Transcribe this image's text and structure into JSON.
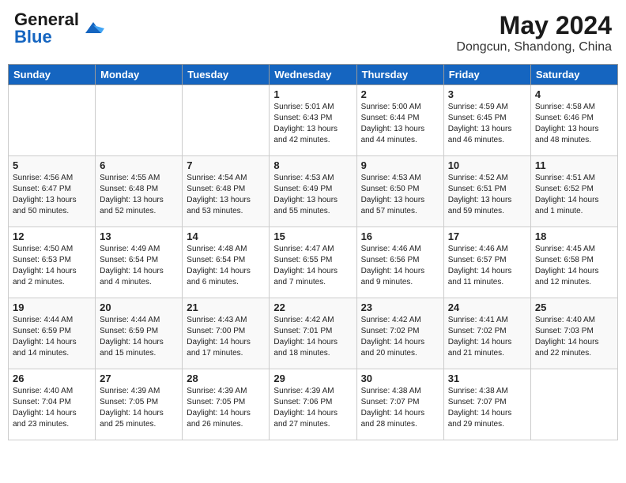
{
  "app": {
    "name": "GeneralBlue",
    "title": "May 2024",
    "subtitle": "Dongcun, Shandong, China"
  },
  "weekdays": [
    "Sunday",
    "Monday",
    "Tuesday",
    "Wednesday",
    "Thursday",
    "Friday",
    "Saturday"
  ],
  "weeks": [
    [
      {
        "day": "",
        "info": ""
      },
      {
        "day": "",
        "info": ""
      },
      {
        "day": "",
        "info": ""
      },
      {
        "day": "1",
        "info": "Sunrise: 5:01 AM\nSunset: 6:43 PM\nDaylight: 13 hours\nand 42 minutes."
      },
      {
        "day": "2",
        "info": "Sunrise: 5:00 AM\nSunset: 6:44 PM\nDaylight: 13 hours\nand 44 minutes."
      },
      {
        "day": "3",
        "info": "Sunrise: 4:59 AM\nSunset: 6:45 PM\nDaylight: 13 hours\nand 46 minutes."
      },
      {
        "day": "4",
        "info": "Sunrise: 4:58 AM\nSunset: 6:46 PM\nDaylight: 13 hours\nand 48 minutes."
      }
    ],
    [
      {
        "day": "5",
        "info": "Sunrise: 4:56 AM\nSunset: 6:47 PM\nDaylight: 13 hours\nand 50 minutes."
      },
      {
        "day": "6",
        "info": "Sunrise: 4:55 AM\nSunset: 6:48 PM\nDaylight: 13 hours\nand 52 minutes."
      },
      {
        "day": "7",
        "info": "Sunrise: 4:54 AM\nSunset: 6:48 PM\nDaylight: 13 hours\nand 53 minutes."
      },
      {
        "day": "8",
        "info": "Sunrise: 4:53 AM\nSunset: 6:49 PM\nDaylight: 13 hours\nand 55 minutes."
      },
      {
        "day": "9",
        "info": "Sunrise: 4:53 AM\nSunset: 6:50 PM\nDaylight: 13 hours\nand 57 minutes."
      },
      {
        "day": "10",
        "info": "Sunrise: 4:52 AM\nSunset: 6:51 PM\nDaylight: 13 hours\nand 59 minutes."
      },
      {
        "day": "11",
        "info": "Sunrise: 4:51 AM\nSunset: 6:52 PM\nDaylight: 14 hours\nand 1 minute."
      }
    ],
    [
      {
        "day": "12",
        "info": "Sunrise: 4:50 AM\nSunset: 6:53 PM\nDaylight: 14 hours\nand 2 minutes."
      },
      {
        "day": "13",
        "info": "Sunrise: 4:49 AM\nSunset: 6:54 PM\nDaylight: 14 hours\nand 4 minutes."
      },
      {
        "day": "14",
        "info": "Sunrise: 4:48 AM\nSunset: 6:54 PM\nDaylight: 14 hours\nand 6 minutes."
      },
      {
        "day": "15",
        "info": "Sunrise: 4:47 AM\nSunset: 6:55 PM\nDaylight: 14 hours\nand 7 minutes."
      },
      {
        "day": "16",
        "info": "Sunrise: 4:46 AM\nSunset: 6:56 PM\nDaylight: 14 hours\nand 9 minutes."
      },
      {
        "day": "17",
        "info": "Sunrise: 4:46 AM\nSunset: 6:57 PM\nDaylight: 14 hours\nand 11 minutes."
      },
      {
        "day": "18",
        "info": "Sunrise: 4:45 AM\nSunset: 6:58 PM\nDaylight: 14 hours\nand 12 minutes."
      }
    ],
    [
      {
        "day": "19",
        "info": "Sunrise: 4:44 AM\nSunset: 6:59 PM\nDaylight: 14 hours\nand 14 minutes."
      },
      {
        "day": "20",
        "info": "Sunrise: 4:44 AM\nSunset: 6:59 PM\nDaylight: 14 hours\nand 15 minutes."
      },
      {
        "day": "21",
        "info": "Sunrise: 4:43 AM\nSunset: 7:00 PM\nDaylight: 14 hours\nand 17 minutes."
      },
      {
        "day": "22",
        "info": "Sunrise: 4:42 AM\nSunset: 7:01 PM\nDaylight: 14 hours\nand 18 minutes."
      },
      {
        "day": "23",
        "info": "Sunrise: 4:42 AM\nSunset: 7:02 PM\nDaylight: 14 hours\nand 20 minutes."
      },
      {
        "day": "24",
        "info": "Sunrise: 4:41 AM\nSunset: 7:02 PM\nDaylight: 14 hours\nand 21 minutes."
      },
      {
        "day": "25",
        "info": "Sunrise: 4:40 AM\nSunset: 7:03 PM\nDaylight: 14 hours\nand 22 minutes."
      }
    ],
    [
      {
        "day": "26",
        "info": "Sunrise: 4:40 AM\nSunset: 7:04 PM\nDaylight: 14 hours\nand 23 minutes."
      },
      {
        "day": "27",
        "info": "Sunrise: 4:39 AM\nSunset: 7:05 PM\nDaylight: 14 hours\nand 25 minutes."
      },
      {
        "day": "28",
        "info": "Sunrise: 4:39 AM\nSunset: 7:05 PM\nDaylight: 14 hours\nand 26 minutes."
      },
      {
        "day": "29",
        "info": "Sunrise: 4:39 AM\nSunset: 7:06 PM\nDaylight: 14 hours\nand 27 minutes."
      },
      {
        "day": "30",
        "info": "Sunrise: 4:38 AM\nSunset: 7:07 PM\nDaylight: 14 hours\nand 28 minutes."
      },
      {
        "day": "31",
        "info": "Sunrise: 4:38 AM\nSunset: 7:07 PM\nDaylight: 14 hours\nand 29 minutes."
      },
      {
        "day": "",
        "info": ""
      }
    ]
  ]
}
